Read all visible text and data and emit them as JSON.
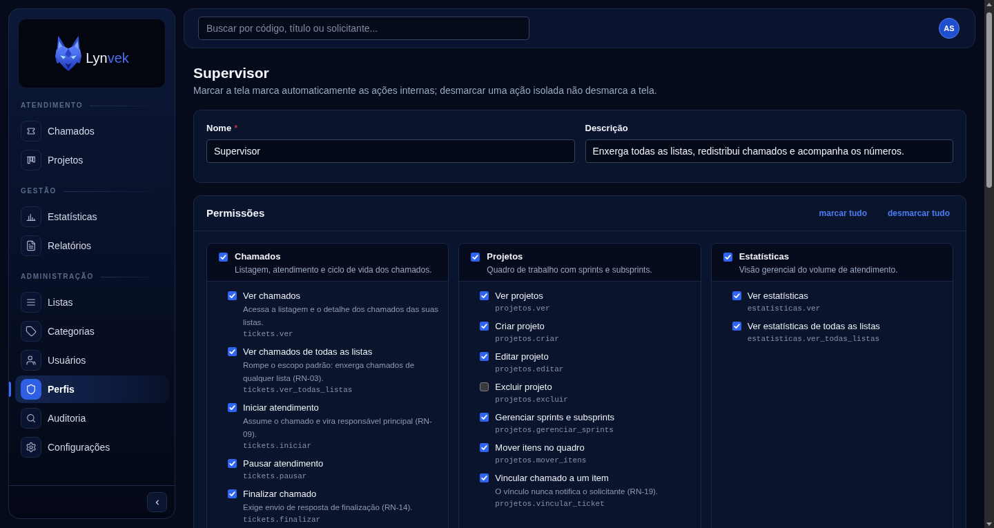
{
  "sidebar": {
    "logo": {
      "name_parts": [
        {
          "text": "Lyn",
          "accent": false
        },
        {
          "text": "vek",
          "accent": true
        }
      ]
    },
    "sections": [
      {
        "label": "ATENDIMENTO",
        "items": [
          {
            "label": "Chamados",
            "selected": false
          },
          {
            "label": "Projetos",
            "selected": false
          }
        ]
      },
      {
        "label": "GESTÃO",
        "items": [
          {
            "label": "Estatísticas",
            "selected": false
          },
          {
            "label": "Relatórios",
            "selected": false
          }
        ]
      },
      {
        "label": "ADMINISTRAÇÃO",
        "items": [
          {
            "label": "Listas",
            "selected": false
          },
          {
            "label": "Categorias",
            "selected": false
          },
          {
            "label": "Usuários",
            "selected": false
          },
          {
            "label": "Perfis",
            "selected": true
          },
          {
            "label": "Auditoria",
            "selected": false
          },
          {
            "label": "Configurações",
            "selected": false
          }
        ]
      }
    ]
  },
  "top_bar": {
    "search": {
      "placeholder": "Buscar por código, título ou solicitante..."
    },
    "avatar": {
      "initials": "AS"
    }
  },
  "page": {
    "title": "Supervisor",
    "subtitle": "Marcar a tela marca automaticamente as ações internas; desmarcar uma ação isolada não desmarca a tela."
  },
  "form": {
    "fields": [
      {
        "label": "Nome",
        "required_mark": "*",
        "value": "Supervisor"
      },
      {
        "label": "Descrição",
        "value": "Enxerga todas as listas, redistribui chamados e acompanha os números."
      }
    ]
  },
  "permissions": {
    "title": "Permissões",
    "actions": [
      "marcar tudo",
      "desmarcar tudo"
    ],
    "groups": [
      {
        "title": "Chamados",
        "description": "Listagem, atendimento e ciclo de vida dos chamados.",
        "checked": true,
        "items": [
          {
            "label": "Ver chamados",
            "description": "Acessa a listagem e o detalhe dos chamados das suas listas.",
            "code": "tickets.ver",
            "checked": true
          },
          {
            "label": "Ver chamados de todas as listas",
            "description": "Rompe o escopo padrão: enxerga chamados de qualquer lista (RN-03).",
            "code": "tickets.ver_todas_listas",
            "checked": true
          },
          {
            "label": "Iniciar atendimento",
            "description": "Assume o chamado e vira responsável principal (RN-09).",
            "code": "tickets.iniciar",
            "checked": true
          },
          {
            "label": "Pausar atendimento",
            "code": "tickets.pausar",
            "checked": true
          },
          {
            "label": "Finalizar chamado",
            "description": "Exige envio de resposta de finalização (RN-14).",
            "code": "tickets.finalizar",
            "checked": true
          }
        ]
      },
      {
        "title": "Projetos",
        "description": "Quadro de trabalho com sprints e subsprints.",
        "checked": true,
        "items": [
          {
            "label": "Ver projetos",
            "code": "projetos.ver",
            "checked": true
          },
          {
            "label": "Criar projeto",
            "code": "projetos.criar",
            "checked": true
          },
          {
            "label": "Editar projeto",
            "code": "projetos.editar",
            "checked": true
          },
          {
            "label": "Excluir projeto",
            "code": "projetos.excluir",
            "checked": false
          },
          {
            "label": "Gerenciar sprints e subsprints",
            "code": "projetos.gerenciar_sprints",
            "checked": true
          },
          {
            "label": "Mover itens no quadro",
            "code": "projetos.mover_itens",
            "checked": true
          },
          {
            "label": "Vincular chamado a um item",
            "description": "O vínculo nunca notifica o solicitante (RN-19).",
            "code": "projetos.vincular_ticket",
            "checked": true
          }
        ]
      },
      {
        "title": "Estatísticas",
        "description": "Visão gerencial do volume de atendimento.",
        "checked": true,
        "items": [
          {
            "label": "Ver estatísticas",
            "code": "estatisticas.ver",
            "checked": true
          },
          {
            "label": "Ver estatísticas de todas as listas",
            "code": "estatisticas.ver_todas_listas",
            "checked": true
          }
        ]
      }
    ]
  }
}
